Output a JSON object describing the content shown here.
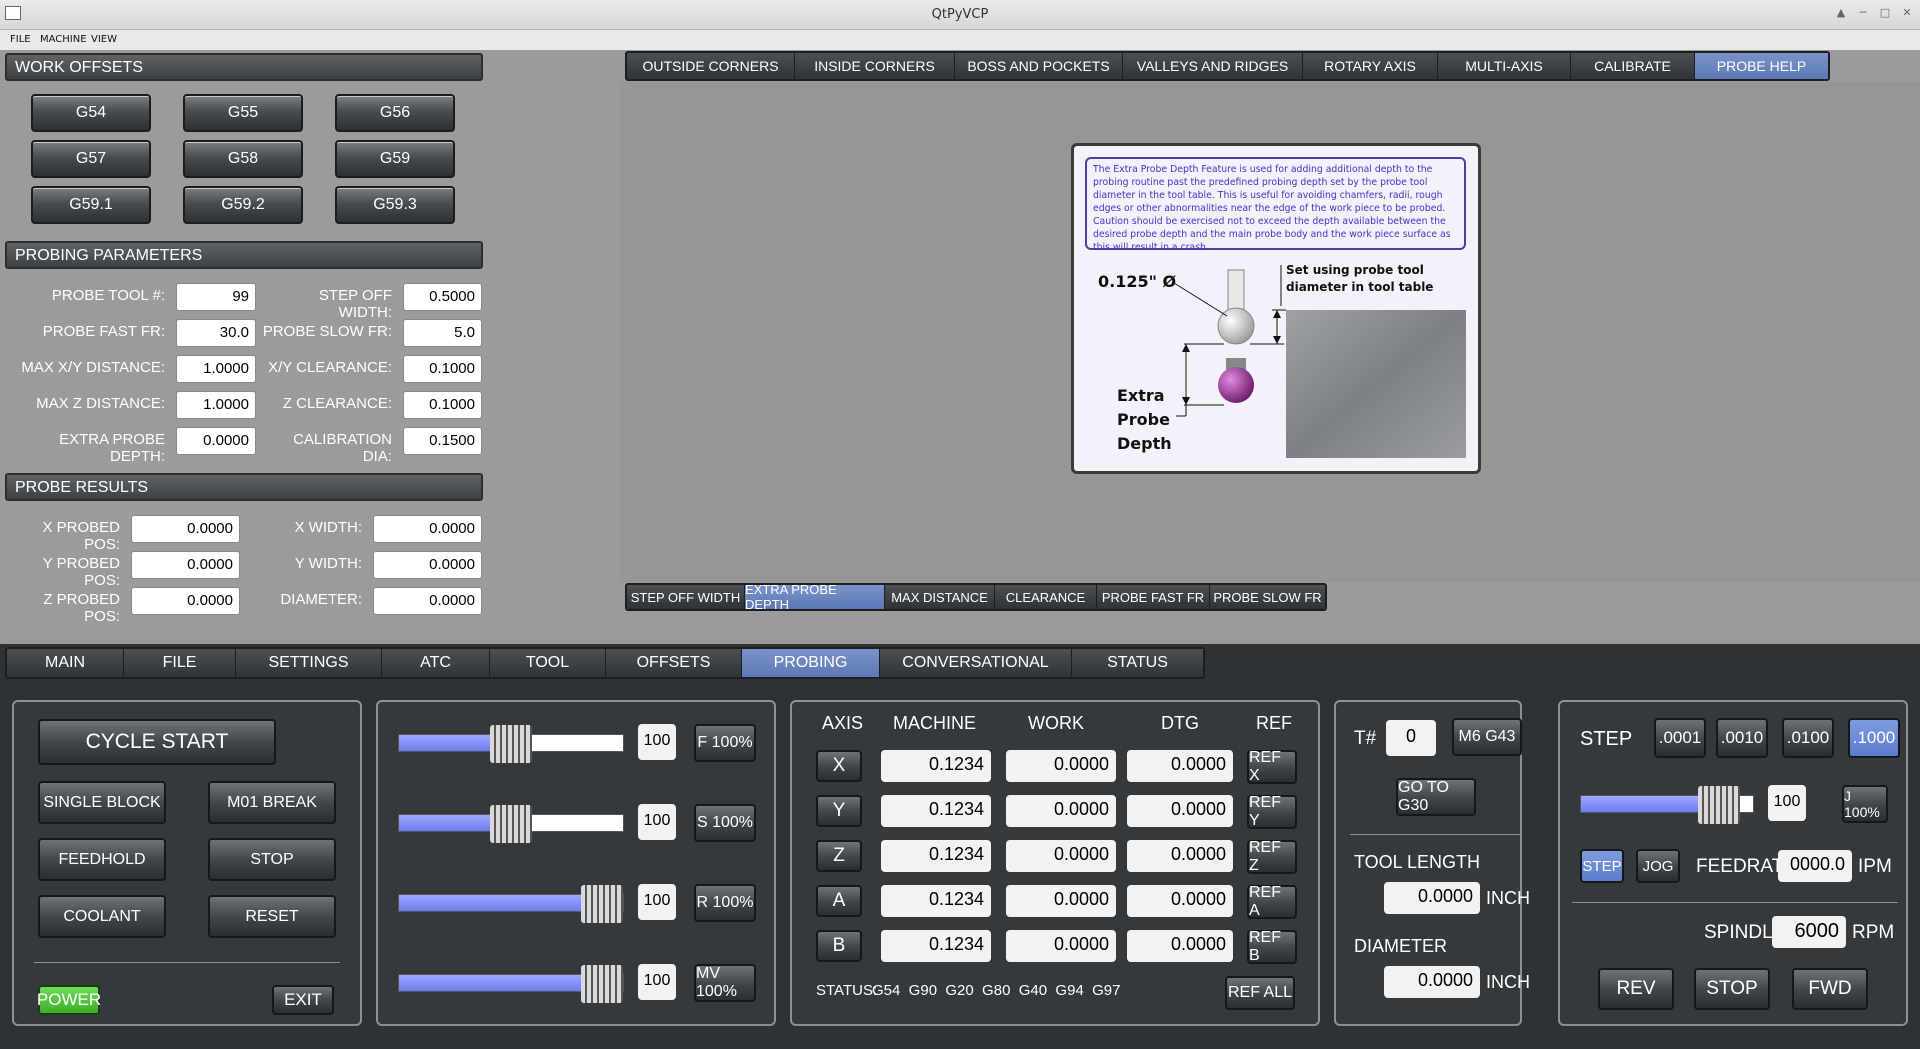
{
  "window": {
    "title": "QtPyVCP"
  },
  "menu": {
    "items": [
      "FILE",
      "MACHINE",
      "VIEW"
    ]
  },
  "work_offsets": {
    "header": "WORK OFFSETS",
    "buttons": [
      "G54",
      "G55",
      "G56",
      "G57",
      "G58",
      "G59",
      "G59.1",
      "G59.2",
      "G59.3"
    ]
  },
  "probing_params": {
    "header": "PROBING PARAMETERS",
    "rows": [
      {
        "l1": "PROBE TOOL #:",
        "v1": "99",
        "l2": "STEP OFF WIDTH:",
        "v2": "0.5000"
      },
      {
        "l1": "PROBE FAST FR:",
        "v1": "30.0",
        "l2": "PROBE SLOW FR:",
        "v2": "5.0"
      },
      {
        "l1": "MAX X/Y DISTANCE:",
        "v1": "1.0000",
        "l2": "X/Y CLEARANCE:",
        "v2": "0.1000"
      },
      {
        "l1": "MAX Z DISTANCE:",
        "v1": "1.0000",
        "l2": "Z CLEARANCE:",
        "v2": "0.1000"
      },
      {
        "l1": "EXTRA PROBE DEPTH:",
        "v1": "0.0000",
        "l2": "CALIBRATION DIA:",
        "v2": "0.1500"
      }
    ]
  },
  "probe_results": {
    "header": "PROBE RESULTS",
    "rows": [
      {
        "l1": "X PROBED POS:",
        "v1": "0.0000",
        "l2": "X WIDTH:",
        "v2": "0.0000"
      },
      {
        "l1": "Y PROBED POS:",
        "v1": "0.0000",
        "l2": "Y WIDTH:",
        "v2": "0.0000"
      },
      {
        "l1": "Z PROBED POS:",
        "v1": "0.0000",
        "l2": "DIAMETER:",
        "v2": "0.0000"
      }
    ]
  },
  "probe_tabs": [
    "OUTSIDE CORNERS",
    "INSIDE CORNERS",
    "BOSS AND POCKETS",
    "VALLEYS AND RIDGES",
    "ROTARY AXIS",
    "MULTI-AXIS",
    "CALIBRATE",
    "PROBE HELP"
  ],
  "help_tabs": [
    "STEP OFF WIDTH",
    "EXTRA PROBE DEPTH",
    "MAX DISTANCE",
    "CLEARANCE",
    "PROBE FAST FR",
    "PROBE SLOW FR"
  ],
  "help_image": {
    "text": "The Extra Probe Depth Feature is used for adding additional depth to the probing routine past the predefined probing depth set by the probe tool diameter in the tool table.  This is useful for avoiding chamfers, radii, rough edges or other abnormalities near the edge of the work piece to be probed.  Caution should be exercised not to exceed the depth available between the desired probe depth and the main probe body and the work piece surface as this will result in a crash.",
    "dia_label": "0.125\" Ø",
    "note_line1": "Set using probe tool",
    "note_line2": "diameter in tool table",
    "depth_l1": "Extra",
    "depth_l2": "Probe",
    "depth_l3": "Depth"
  },
  "main_tabs": [
    "MAIN",
    "FILE",
    "SETTINGS",
    "ATC",
    "TOOL",
    "OFFSETS",
    "PROBING",
    "CONVERSATIONAL",
    "STATUS"
  ],
  "control": {
    "cycle_start": "CYCLE START",
    "single_block": "SINGLE BLOCK",
    "m01_break": "M01 BREAK",
    "feedhold": "FEEDHOLD",
    "stop": "STOP",
    "coolant": "COOLANT",
    "reset": "RESET",
    "power": "POWER",
    "exit": "EXIT"
  },
  "overrides": [
    {
      "value": "100",
      "button": "F 100%",
      "level": 0.5
    },
    {
      "value": "100",
      "button": "S 100%",
      "level": 0.5
    },
    {
      "value": "100",
      "button": "R 100%",
      "level": 1.0
    },
    {
      "value": "100",
      "button": "MV 100%",
      "level": 1.0
    }
  ],
  "dro": {
    "headers": {
      "axis": "AXIS",
      "machine": "MACHINE",
      "work": "WORK",
      "dtg": "DTG",
      "ref": "REF"
    },
    "rows": [
      {
        "axis": "X",
        "machine": "0.1234",
        "work": "0.0000",
        "dtg": "0.0000",
        "ref": "REF X"
      },
      {
        "axis": "Y",
        "machine": "0.1234",
        "work": "0.0000",
        "dtg": "0.0000",
        "ref": "REF Y"
      },
      {
        "axis": "Z",
        "machine": "0.1234",
        "work": "0.0000",
        "dtg": "0.0000",
        "ref": "REF Z"
      },
      {
        "axis": "A",
        "machine": "0.1234",
        "work": "0.0000",
        "dtg": "0.0000",
        "ref": "REF A"
      },
      {
        "axis": "B",
        "machine": "0.1234",
        "work": "0.0000",
        "dtg": "0.0000",
        "ref": "REF B"
      }
    ],
    "status_label": "STATUS:",
    "status": "G54  G90  G20  G80  G40  G94  G97",
    "ref_all": "REF ALL"
  },
  "tool": {
    "t_label": "T#",
    "t_value": "0",
    "m6": "M6 G43",
    "go_g30": "GO TO G30",
    "length_label": "TOOL LENGTH",
    "length_value": "0.0000",
    "length_unit": "INCH",
    "dia_label": "DIAMETER",
    "dia_value": "0.0000",
    "dia_unit": "INCH"
  },
  "jog": {
    "step_label": "STEP",
    "steps": [
      ".0001",
      ".0010",
      ".0100",
      ".1000"
    ],
    "jog_value": "100",
    "jog_button": "J 100%",
    "jog_level": 0.8,
    "mode_step": "STEP",
    "mode_jog": "JOG",
    "feedrate_label": "FEEDRATE",
    "feedrate_value": "0000.0",
    "feedrate_unit": "IPM",
    "spindle_label": "SPINDLE",
    "spindle_value": "6000",
    "spindle_unit": "RPM",
    "rev": "REV",
    "stop": "STOP",
    "fwd": "FWD"
  }
}
